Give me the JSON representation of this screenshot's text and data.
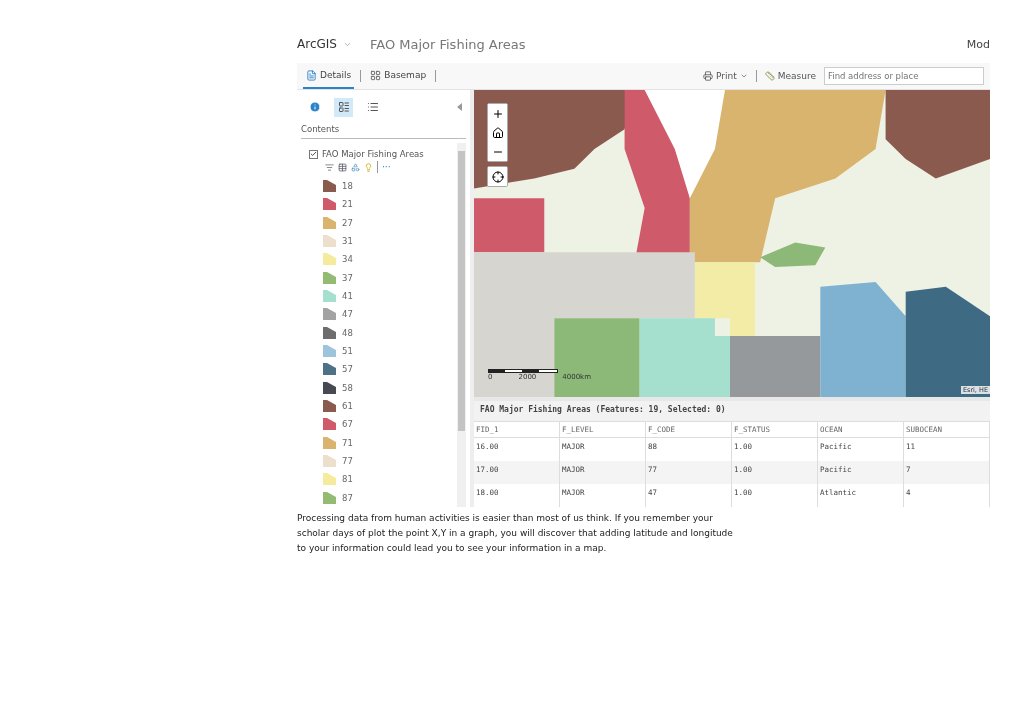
{
  "header": {
    "app": "ArcGIS",
    "title": "FAO Major Fishing Areas",
    "right_text": "Mod"
  },
  "toolbar": {
    "tabs": [
      {
        "label": "Details",
        "kind": "details",
        "selected": true
      },
      {
        "label": "Basemap",
        "kind": "basemap",
        "selected": false
      }
    ],
    "print": "Print",
    "measure": "Measure",
    "search": {
      "placeholder": "Find address or place"
    }
  },
  "panel": {
    "views": [
      {
        "kind": "about",
        "selected": false
      },
      {
        "kind": "content",
        "selected": true
      },
      {
        "kind": "legend",
        "selected": false
      }
    ],
    "heading": "Contents",
    "layer": {
      "name": "FAO Major Fishing Areas",
      "checked": true,
      "more": "···"
    },
    "legend": [
      {
        "label": "18",
        "color": "#8b5a4f"
      },
      {
        "label": "21",
        "color": "#cf5a6a"
      },
      {
        "label": "27",
        "color": "#d8b46e"
      },
      {
        "label": "31",
        "color": "#ece0cc"
      },
      {
        "label": "34",
        "color": "#f4ec9c"
      },
      {
        "label": "37",
        "color": "#93bb72"
      },
      {
        "label": "41",
        "color": "#a5e0cf"
      },
      {
        "label": "47",
        "color": "#a3a3a3"
      },
      {
        "label": "48",
        "color": "#6d6d6d"
      },
      {
        "label": "51",
        "color": "#9cc4da"
      },
      {
        "label": "57",
        "color": "#4f7185"
      },
      {
        "label": "58",
        "color": "#474a50"
      },
      {
        "label": "61",
        "color": "#8b5a4f"
      },
      {
        "label": "67",
        "color": "#cf5a6a"
      },
      {
        "label": "71",
        "color": "#d8b46e"
      },
      {
        "label": "77",
        "color": "#ece0cc"
      },
      {
        "label": "81",
        "color": "#f4ec9c"
      },
      {
        "label": "87",
        "color": "#93bb72"
      }
    ]
  },
  "map": {
    "scale": [
      "0",
      "2000",
      "4000km"
    ],
    "attribution": "Esri, HE"
  },
  "table": {
    "title": "FAO Major Fishing Areas (Features: 19, Selected: 0)",
    "columns": [
      "FID_1",
      "F_LEVEL",
      "F_CODE",
      "F_STATUS",
      "OCEAN",
      "SUBOCEAN"
    ],
    "rows": [
      [
        "16.00",
        "MAJOR",
        "88",
        "1.00",
        "Pacific",
        "11"
      ],
      [
        "17.00",
        "MAJOR",
        "77",
        "1.00",
        "Pacific",
        "7"
      ],
      [
        "18.00",
        "MAJOR",
        "47",
        "1.00",
        "Atlantic",
        "4"
      ]
    ]
  },
  "caption": "Processing data from human activities is easier than most of us think. If you remember your scholar days of plot the point X,Y in a graph, you will discover that adding latitude and longitude to your information could lead you to see your information in a map."
}
